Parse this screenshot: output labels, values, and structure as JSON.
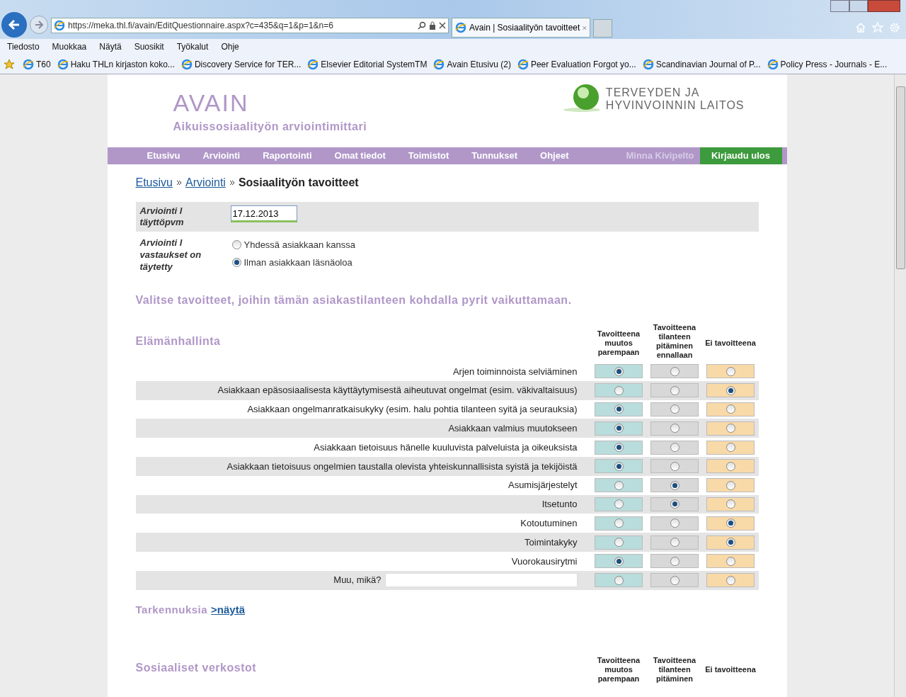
{
  "browser": {
    "url": "https://meka.thl.fi/avain/EditQuestionnaire.aspx?c=435&q=1&p=1&n=6",
    "tab_title": "Avain | Sosiaalityön tavoitteet",
    "menu": [
      "Tiedosto",
      "Muokkaa",
      "Näytä",
      "Suosikit",
      "Työkalut",
      "Ohje"
    ],
    "favorites": [
      "T60",
      "Haku THLn kirjaston koko...",
      "Discovery Service for TER...",
      "Elsevier Editorial SystemTM",
      "Avain  Etusivu (2)",
      "Peer Evaluation  Forgot yo...",
      "Scandinavian Journal of P...",
      "Policy Press - Journals - E..."
    ]
  },
  "header": {
    "title": "AVAIN",
    "subtitle": "Aikuissosiaalityön arviointimittari",
    "org_lines": [
      "TERVEYDEN JA",
      "HYVINVOINNIN LAITOS"
    ]
  },
  "nav": {
    "items": [
      "Etusivu",
      "Arviointi",
      "Raportointi",
      "Omat tiedot",
      "Toimistot",
      "Tunnukset",
      "Ohjeet"
    ],
    "user": "Minna Kivipelto",
    "logout": "Kirjaudu ulos"
  },
  "breadcrumb": {
    "links": [
      "Etusivu",
      "Arviointi"
    ],
    "current": "Sosiaalityön tavoitteet"
  },
  "form": {
    "date_label": "Arviointi l täyttöpvm",
    "date_value": "17.12.2013",
    "mode_label": "Arviointi l vastaukset on täytetty",
    "mode_options": [
      {
        "label": "Yhdessä asiakkaan kanssa",
        "selected": false
      },
      {
        "label": "Ilman asiakkaan läsnäoloa",
        "selected": true
      }
    ]
  },
  "instruction": "Valitse tavoitteet, joihin tämän asiakastilanteen kohdalla pyrit vaikuttamaan.",
  "sections": [
    {
      "title": "Elämänhallinta",
      "columns": [
        "Tavoitteena muutos parempaan",
        "Tavoitteena tilanteen pitäminen ennallaan",
        "Ei tavoitteena"
      ],
      "rows": [
        {
          "kind": "item",
          "label": "Arjen toiminnoista selviäminen",
          "options": [
            {
              "selected": true
            },
            {
              "selected": false
            },
            {
              "selected": false
            }
          ]
        },
        {
          "kind": "item",
          "label": "Asiakkaan epäsosiaalisesta käyttäytymisestä aiheutuvat ongelmat (esim. väkivaltaisuus)",
          "options": [
            {
              "selected": false
            },
            {
              "selected": false
            },
            {
              "selected": true
            }
          ]
        },
        {
          "kind": "item",
          "label": "Asiakkaan ongelmanratkaisukyky (esim. halu pohtia tilanteen syitä ja seurauksia)",
          "options": [
            {
              "selected": true
            },
            {
              "selected": false
            },
            {
              "selected": false
            }
          ]
        },
        {
          "kind": "item",
          "label": "Asiakkaan valmius muutokseen",
          "options": [
            {
              "selected": true
            },
            {
              "selected": false
            },
            {
              "selected": false
            }
          ]
        },
        {
          "kind": "item",
          "label": "Asiakkaan tietoisuus hänelle kuuluvista palveluista ja oikeuksista",
          "options": [
            {
              "selected": true
            },
            {
              "selected": false
            },
            {
              "selected": false
            }
          ]
        },
        {
          "kind": "item",
          "label": "Asiakkaan tietoisuus ongelmien taustalla olevista yhteiskunnallisista syistä ja tekijöistä",
          "options": [
            {
              "selected": true
            },
            {
              "selected": false
            },
            {
              "selected": false
            }
          ]
        },
        {
          "kind": "item",
          "label": "Asumisjärjestelyt",
          "options": [
            {
              "selected": false
            },
            {
              "selected": true
            },
            {
              "selected": false
            }
          ]
        },
        {
          "kind": "item",
          "label": "Itsetunto",
          "options": [
            {
              "selected": false
            },
            {
              "selected": true
            },
            {
              "selected": false
            }
          ]
        },
        {
          "kind": "item",
          "label": "Kotoutuminen",
          "options": [
            {
              "selected": false
            },
            {
              "selected": false
            },
            {
              "selected": true
            }
          ]
        },
        {
          "kind": "item",
          "label": "Toimintakyky",
          "options": [
            {
              "selected": false
            },
            {
              "selected": false
            },
            {
              "selected": true
            }
          ]
        },
        {
          "kind": "item",
          "label": "Vuorokausirytmi",
          "options": [
            {
              "selected": true
            },
            {
              "selected": false
            },
            {
              "selected": false
            }
          ]
        },
        {
          "kind": "other",
          "label": "Muu, mikä?",
          "options": [
            {
              "selected": false
            },
            {
              "selected": false
            },
            {
              "selected": false
            }
          ]
        }
      ],
      "more_label": "Tarkennuksia",
      "more_link": ">näytä"
    },
    {
      "title": "Sosiaaliset verkostot",
      "columns": [
        "Tavoitteena muutos parempaan",
        "Tavoitteena tilanteen pitäminen",
        "Ei tavoitteena"
      ]
    }
  ]
}
